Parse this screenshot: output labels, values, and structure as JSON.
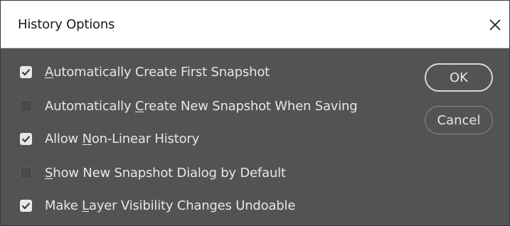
{
  "window": {
    "title": "History Options",
    "close_icon": "close-icon"
  },
  "options": [
    {
      "pre": "",
      "mnemonic": "A",
      "post": "utomatically Create First Snapshot",
      "checked": true
    },
    {
      "pre": "Automatically ",
      "mnemonic": "C",
      "post": "reate New Snapshot When Saving",
      "checked": false
    },
    {
      "pre": "Allow ",
      "mnemonic": "N",
      "post": "on-Linear History",
      "checked": true
    },
    {
      "pre": "",
      "mnemonic": "S",
      "post": "how New Snapshot Dialog by Default",
      "checked": false
    },
    {
      "pre": "Make ",
      "mnemonic": "L",
      "post": "ayer Visibility Changes Undoable",
      "checked": true
    }
  ],
  "buttons": {
    "ok": "OK",
    "cancel": "Cancel"
  },
  "colors": {
    "dialog_bg": "#535353",
    "titlebar_bg": "#ffffff",
    "text": "#e6e6e6",
    "checkbox_checked": "#e8e8e8",
    "checkbox_unchecked": "#4a4a4a"
  }
}
